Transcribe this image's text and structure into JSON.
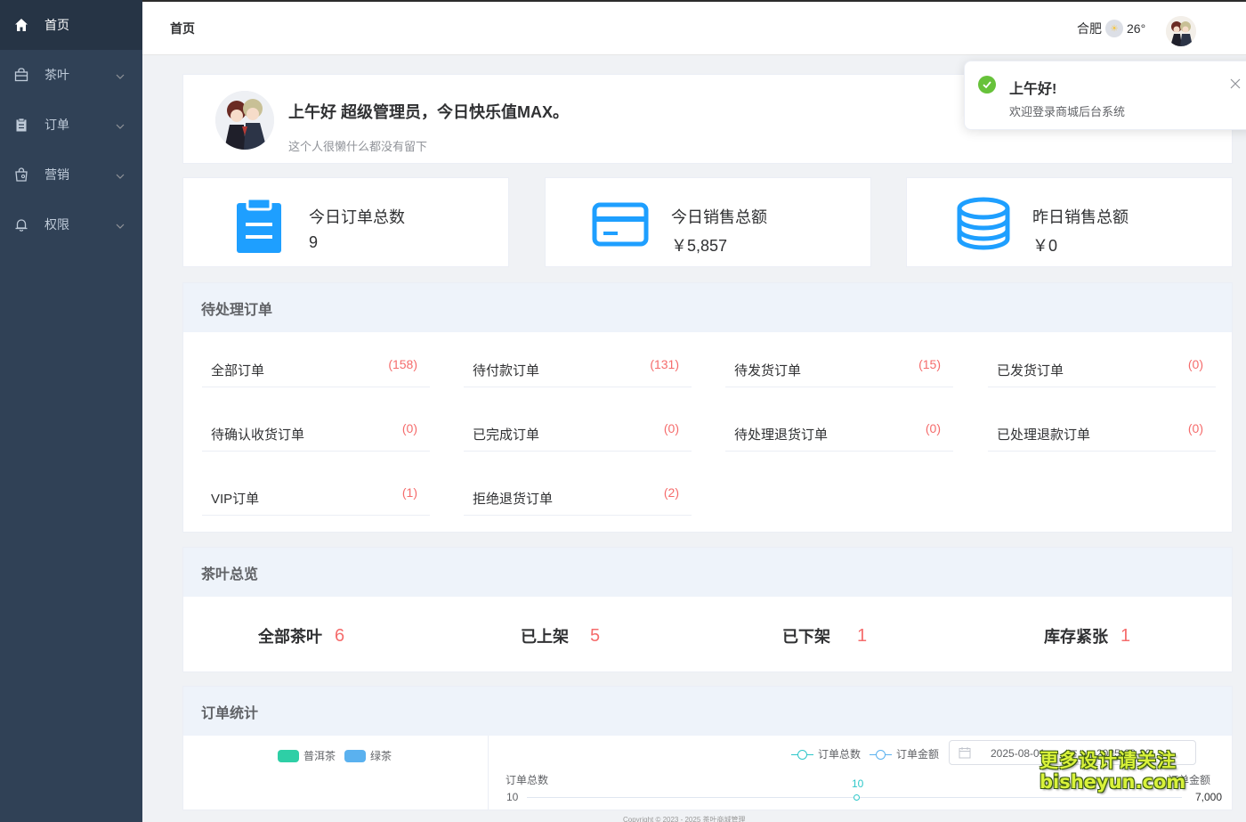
{
  "sidebar": {
    "items": [
      {
        "label": "首页",
        "icon": "home-icon",
        "active": true
      },
      {
        "label": "茶叶",
        "icon": "bag-icon"
      },
      {
        "label": "订单",
        "icon": "clipboard-icon"
      },
      {
        "label": "营销",
        "icon": "shopping-bag-icon"
      },
      {
        "label": "权限",
        "icon": "bell-icon"
      }
    ]
  },
  "header": {
    "title": "首页",
    "city": "合肥",
    "temperature": "26°",
    "weather_icon": "sun-icon"
  },
  "welcome": {
    "title": "上午好 超级管理员，今日快乐值MAX。",
    "subtitle": "这个人很懒什么都没有留下"
  },
  "stats": [
    {
      "label": "今日订单总数",
      "value": "9",
      "icon": "clipboard-icon"
    },
    {
      "label": "今日销售总额",
      "value": "￥5,857",
      "icon": "credit-card-icon"
    },
    {
      "label": "昨日销售总额",
      "value": "￥0",
      "icon": "coins-icon"
    }
  ],
  "pending": {
    "title": "待处理订单",
    "items": [
      {
        "label": "全部订单",
        "count": "(158)"
      },
      {
        "label": "待付款订单",
        "count": "(131)"
      },
      {
        "label": "待发货订单",
        "count": "(15)"
      },
      {
        "label": "已发货订单",
        "count": "(0)"
      },
      {
        "label": "待确认收货订单",
        "count": "(0)"
      },
      {
        "label": "已完成订单",
        "count": "(0)"
      },
      {
        "label": "待处理退货订单",
        "count": "(0)"
      },
      {
        "label": "已处理退款订单",
        "count": "(0)"
      },
      {
        "label": "VIP订单",
        "count": "(1)"
      },
      {
        "label": "拒绝退货订单",
        "count": "(2)"
      }
    ]
  },
  "tea": {
    "title": "茶叶总览",
    "items": [
      {
        "label": "全部茶叶",
        "value": "6"
      },
      {
        "label": "已上架",
        "value": "5"
      },
      {
        "label": "已下架",
        "value": "1"
      },
      {
        "label": "库存紧张",
        "value": "1"
      }
    ]
  },
  "order_stats": {
    "title": "订单统计",
    "pie_legend": [
      {
        "name": "普洱茶",
        "color": "#2ecfa6"
      },
      {
        "name": "绿茶",
        "color": "#5ab1ef"
      }
    ],
    "line_legend": [
      {
        "name": "订单总数",
        "color": "#2ec7c9"
      },
      {
        "name": "订单金额",
        "color": "#5ab1ef"
      }
    ],
    "date_start": "2025-08-01",
    "date_sep": "至",
    "date_end": "2025-08-30",
    "left_axis_name": "订单总数",
    "right_axis_name": "订单金额",
    "left_axis_top": "10",
    "right_axis_top": "7,000",
    "point_label": "10"
  },
  "footer": "Copyright © 2023 - 2025 茶叶商城管理",
  "toast": {
    "title": "上午好!",
    "message": "欢迎登录商城后台系统",
    "icon": "check-circle-icon",
    "close_icon": "close-icon"
  },
  "watermark": {
    "line1": "更多设计请关注",
    "line2": "bisheyun.com"
  },
  "colors": {
    "sidebar_bg": "#304156",
    "accent_blue": "#1e9fff",
    "count_red": "#f56c6c",
    "success_green": "#67c23a"
  }
}
